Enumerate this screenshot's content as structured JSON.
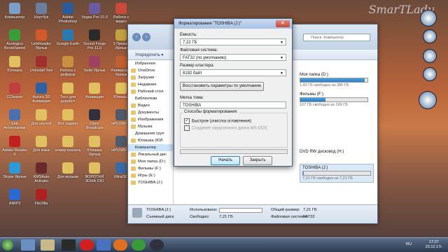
{
  "desktop_icons": [
    {
      "label": "Компьютер",
      "color": "#7a9fc9"
    },
    {
      "label": "Ноутбук",
      "color": "#6a7fa0"
    },
    {
      "label": "Adobe Photoshop",
      "color": "#2a5c9c"
    },
    {
      "label": "Vegas Pro 10.0",
      "color": "#6a5aa0"
    },
    {
      "label": "Работа с видео",
      "color": "#c94a3a"
    },
    {
      "label": "Auslogics BoostSpeed",
      "color": "#3a9c3a"
    },
    {
      "label": "LinkReader Ярлык",
      "color": "#d05a2a"
    },
    {
      "label": "Google Earth",
      "color": "#2a7ab0"
    },
    {
      "label": "Sound Forge Pro 11.0",
      "color": "#2a2a2a"
    },
    {
      "label": "3 Проект Ярлык",
      "color": "#c0a040"
    },
    {
      "label": "Юляшка",
      "color": "#e0c060"
    },
    {
      "label": "Uninstall Tool",
      "color": "#a03030"
    },
    {
      "label": "Работа с рефераі",
      "color": "#c89040"
    },
    {
      "label": "Suite Ярлык",
      "color": "#a04060"
    },
    {
      "label": "Универсаль Ярлык",
      "color": "#c06030"
    },
    {
      "label": "CCleaner",
      "color": "#c04040"
    },
    {
      "label": "Aurora 3D Анимация",
      "color": "#3060a0"
    },
    {
      "label": "Тест для доработ",
      "color": "#e0c060"
    },
    {
      "label": "Анимация",
      "color": "#e0c060"
    },
    {
      "label": "Юляшка",
      "color": "#e0c060"
    },
    {
      "label": "Ebit Антиплагиат",
      "color": "#4a70b0"
    },
    {
      "label": "Для ноутей",
      "color": "#e0c060"
    },
    {
      "label": "Вот задани",
      "color": "#e0c060"
    },
    {
      "label": "Open Broadcast",
      "color": "#303040"
    },
    {
      "label": "HPUSBFW",
      "color": "#505a6a"
    },
    {
      "label": "Adobe Reader X",
      "color": "#c02020"
    },
    {
      "label": "Для кожи",
      "color": "#e0c060"
    },
    {
      "label": "номер кошелъ",
      "color": "#e0c060"
    },
    {
      "label": "Юляшка Ярлык",
      "color": "#e0c060"
    },
    {
      "label": "HPUSBFW",
      "color": "#505a6a"
    },
    {
      "label": "Skype Ярлык",
      "color": "#2a9ad8"
    },
    {
      "label": "KMSAuto Activato",
      "color": "#6a2a2a"
    },
    {
      "label": "Для музыки",
      "color": "#e0c060"
    },
    {
      "label": "ВОРОТНИ ЗОНА СЮ",
      "color": "#e0c060"
    },
    {
      "label": "UltraISO",
      "color": "#3a6aa0"
    },
    {
      "label": "AIMP3",
      "color": "#2a6ad0"
    },
    {
      "label": "FileZilla",
      "color": "#b02020"
    }
  ],
  "watermark": "SmarTLady",
  "explorer": {
    "search_placeholder": "Поиск: Компьютер",
    "organize_label": "Упорядочить ▾",
    "nav_items": [
      {
        "label": "Избранное",
        "type": "head"
      },
      {
        "label": "OneDrive"
      },
      {
        "label": "Загрузки"
      },
      {
        "label": "Недавние"
      },
      {
        "label": "Рабочий стол"
      },
      {
        "label": "Библиотеки",
        "type": "head"
      },
      {
        "label": "Видео"
      },
      {
        "label": "Документы"
      },
      {
        "label": "Изображения"
      },
      {
        "label": "Музыка"
      },
      {
        "label": "Домашняя груп",
        "type": "head"
      },
      {
        "label": "Юляшка (ЮЛ"
      },
      {
        "label": "Компьютер",
        "type": "head",
        "selected": true
      },
      {
        "label": "Локальный дис"
      },
      {
        "label": "Моя папка (D:)"
      },
      {
        "label": "Фильмы (F:)"
      },
      {
        "label": "Игры (E:)"
      },
      {
        "label": "TOSHIBA (J:)"
      }
    ],
    "drives": [
      {
        "name": "Моя папка (D:)",
        "detail": "1,43 ГБ свободно из 385 ГБ",
        "fill": 0.96
      },
      {
        "name": "Фильмы (F:)",
        "detail": "107 ГБ свободно из 169 ГБ",
        "fill": 0.37
      },
      {
        "name": "DVD RW дисковод (H:)",
        "detail": "",
        "fill": null
      },
      {
        "name": "TOSHIBA (J:)",
        "detail": "7,21 ГБ свободно из 7,21 ГБ",
        "fill": 0.01
      }
    ],
    "details": {
      "name": "TOSHIBA (J:)",
      "type": "Съемный диск",
      "used_label": "Использовано:",
      "free_label": "Свободно:",
      "free_value": "7,21 ГБ",
      "total_label": "Общий размер:",
      "total_value": "7,21 ГБ",
      "fs_label": "Файловая система:",
      "fs_value": "FAT32"
    }
  },
  "dialog": {
    "title": "Форматирование \"TOSHIBA (J:)\"",
    "close": "✕",
    "capacity_label": "Емкость:",
    "capacity_value": "7,22 ГБ",
    "fs_label": "Файловая система:",
    "fs_value": "FAT32 (по умолчанию)",
    "cluster_label": "Размер кластера:",
    "cluster_value": "8192 байт",
    "restore_button": "Восстановить параметры по умолчанию",
    "volume_label": "Метка тома:",
    "volume_value": "TOSHIBA",
    "methods_label": "Способы форматирования:",
    "quick_label": "Быстрое (очистка оглавления)",
    "msdos_label": "Создание загрузочного диска MS-DOS",
    "start_button": "Начать",
    "close_button": "Закрыть",
    "progress": 0
  },
  "taskbar": {
    "lang": "RU",
    "time": "17:27",
    "date": "23.12.17г."
  }
}
